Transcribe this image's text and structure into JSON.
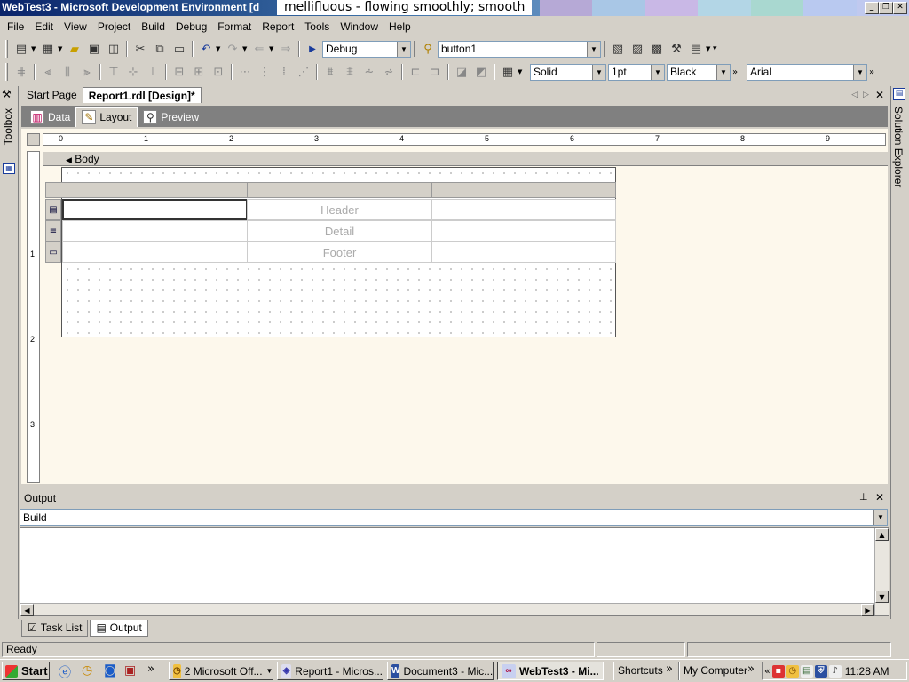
{
  "window": {
    "title": "WebTest3 - Microsoft Development Environment [d",
    "overlay_text": "mellifluous - flowing smoothly; smooth",
    "overlay_colors": [
      "#b6a9d6",
      "#a9c7e6",
      "#c9b8e6",
      "#b3d6e6",
      "#a9d8d0",
      "#b9c9f0",
      "#c0c9ef"
    ],
    "buttons": [
      "_",
      "❐",
      "✕"
    ]
  },
  "menu": [
    "File",
    "Edit",
    "View",
    "Project",
    "Build",
    "Debug",
    "Format",
    "Report",
    "Tools",
    "Window",
    "Help"
  ],
  "toolbar1": {
    "config_value": "Debug",
    "target_value": "button1"
  },
  "toolbar2": {
    "line_style": "Solid",
    "line_width": "1pt",
    "line_color": "Black",
    "font": "Arial"
  },
  "left_panel": {
    "label": "Toolbox"
  },
  "right_panel": {
    "label": "Solution Explorer"
  },
  "doc_tabs": [
    {
      "label": "Start Page",
      "active": false
    },
    {
      "label": "Report1.rdl [Design]*",
      "active": true
    }
  ],
  "design_tabs": [
    {
      "label": "Data",
      "icon": "data-icon",
      "active": false
    },
    {
      "label": "Layout",
      "icon": "layout-icon",
      "active": true
    },
    {
      "label": "Preview",
      "icon": "preview-icon",
      "active": false
    }
  ],
  "ruler": {
    "h_numbers": [
      "0",
      "1",
      "2",
      "3",
      "4",
      "5",
      "6",
      "7",
      "8",
      "9"
    ],
    "v_numbers": [
      "1",
      "2",
      "3"
    ]
  },
  "report": {
    "section_label": "Body",
    "rows": [
      "Header",
      "Detail",
      "Footer"
    ]
  },
  "output": {
    "title": "Output",
    "selected_pane": "Build"
  },
  "bottom_tabs": [
    {
      "label": "Task List",
      "active": false
    },
    {
      "label": "Output",
      "active": true
    }
  ],
  "status": {
    "text": "Ready"
  },
  "taskbar": {
    "start": "Start",
    "tasks": [
      {
        "label": "2 Microsoft Off...",
        "active": false
      },
      {
        "label": "Report1 - Micros...",
        "active": false
      },
      {
        "label": "Document3 - Mic...",
        "active": false
      },
      {
        "label": "WebTest3 - Mi...",
        "active": true
      }
    ],
    "shortcuts": "Shortcuts",
    "my_computer": "My Computer",
    "clock": "11:28 AM"
  }
}
